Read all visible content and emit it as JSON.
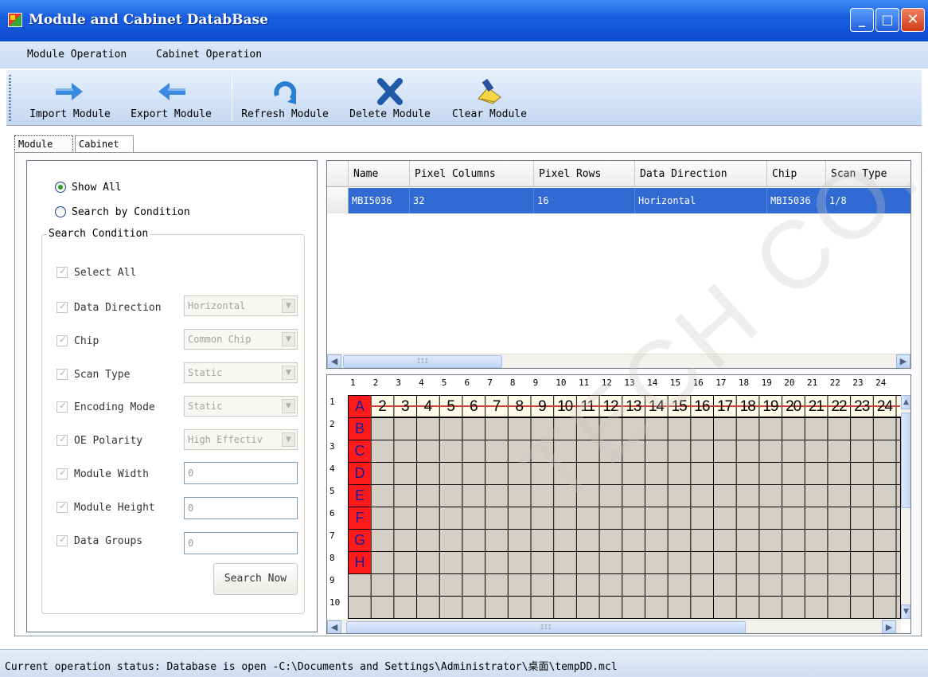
{
  "window": {
    "title": "Module and Cabinet DatabBase"
  },
  "menu": [
    "Module Operation",
    "Cabinet Operation"
  ],
  "toolbar": [
    {
      "label": "Import Module",
      "icon": "arrow-right-icon"
    },
    {
      "label": "Export Module",
      "icon": "arrow-left-icon"
    },
    {
      "label": "Refresh Module",
      "icon": "refresh-icon"
    },
    {
      "label": "Delete Module",
      "icon": "delete-x-icon"
    },
    {
      "label": "Clear Module",
      "icon": "brush-icon"
    }
  ],
  "tabs": [
    "Module",
    "Cabinet"
  ],
  "filter": {
    "show_all": "Show All",
    "search_by_condition": "Search by Condition",
    "show_all_selected": true,
    "group_title": "Search Condition",
    "select_all": "Select All",
    "fields": [
      {
        "label": "Data Direction",
        "type": "combo",
        "value": "Horizontal"
      },
      {
        "label": "Chip",
        "type": "combo",
        "value": "Common Chip"
      },
      {
        "label": "Scan Type",
        "type": "combo",
        "value": "Static"
      },
      {
        "label": "Encoding Mode",
        "type": "combo",
        "value": "Static"
      },
      {
        "label": "OE Polarity",
        "type": "combo",
        "value": "High Effectiv"
      },
      {
        "label": "Module Width",
        "type": "text",
        "value": "0"
      },
      {
        "label": "Module Height",
        "type": "text",
        "value": "0"
      },
      {
        "label": "Data Groups",
        "type": "text",
        "value": "0"
      }
    ],
    "search_button": "Search Now"
  },
  "table": {
    "columns": [
      "Name",
      "Pixel Columns",
      "Pixel Rows",
      "Data Direction",
      "Chip",
      "Scan Type"
    ],
    "rows": [
      [
        "MBI5036",
        "32",
        "16",
        "Horizontal",
        "MBI5036",
        "1/8"
      ]
    ],
    "scroll_grip": "III"
  },
  "pixel_grid": {
    "column_numbers": [
      "1",
      "2",
      "3",
      "4",
      "5",
      "6",
      "7",
      "8",
      "9",
      "10",
      "11",
      "12",
      "13",
      "14",
      "15",
      "16",
      "17",
      "18",
      "19",
      "20",
      "21",
      "22",
      "23",
      "24"
    ],
    "row_numbers": [
      "1",
      "2",
      "3",
      "4",
      "5",
      "6",
      "7",
      "8",
      "9",
      "10"
    ],
    "row1_cells": [
      "A",
      "2",
      "3",
      "4",
      "5",
      "6",
      "7",
      "8",
      "9",
      "10",
      "11",
      "12",
      "13",
      "14",
      "15",
      "16",
      "17",
      "18",
      "19",
      "20",
      "21",
      "22",
      "23",
      "24"
    ],
    "col1_cells": [
      "B",
      "C",
      "D",
      "E",
      "F",
      "G",
      "H"
    ],
    "scroll_grip": "III"
  },
  "watermark": "TECH CO., L",
  "status": "Current operation status: Database is open -C:\\Documents and Settings\\Administrator\\桌面\\tempDD.mcl",
  "colors": {
    "titlebar": "#1a5fe0",
    "selection": "#306ad2",
    "red_cell": "#ff1a1a"
  }
}
